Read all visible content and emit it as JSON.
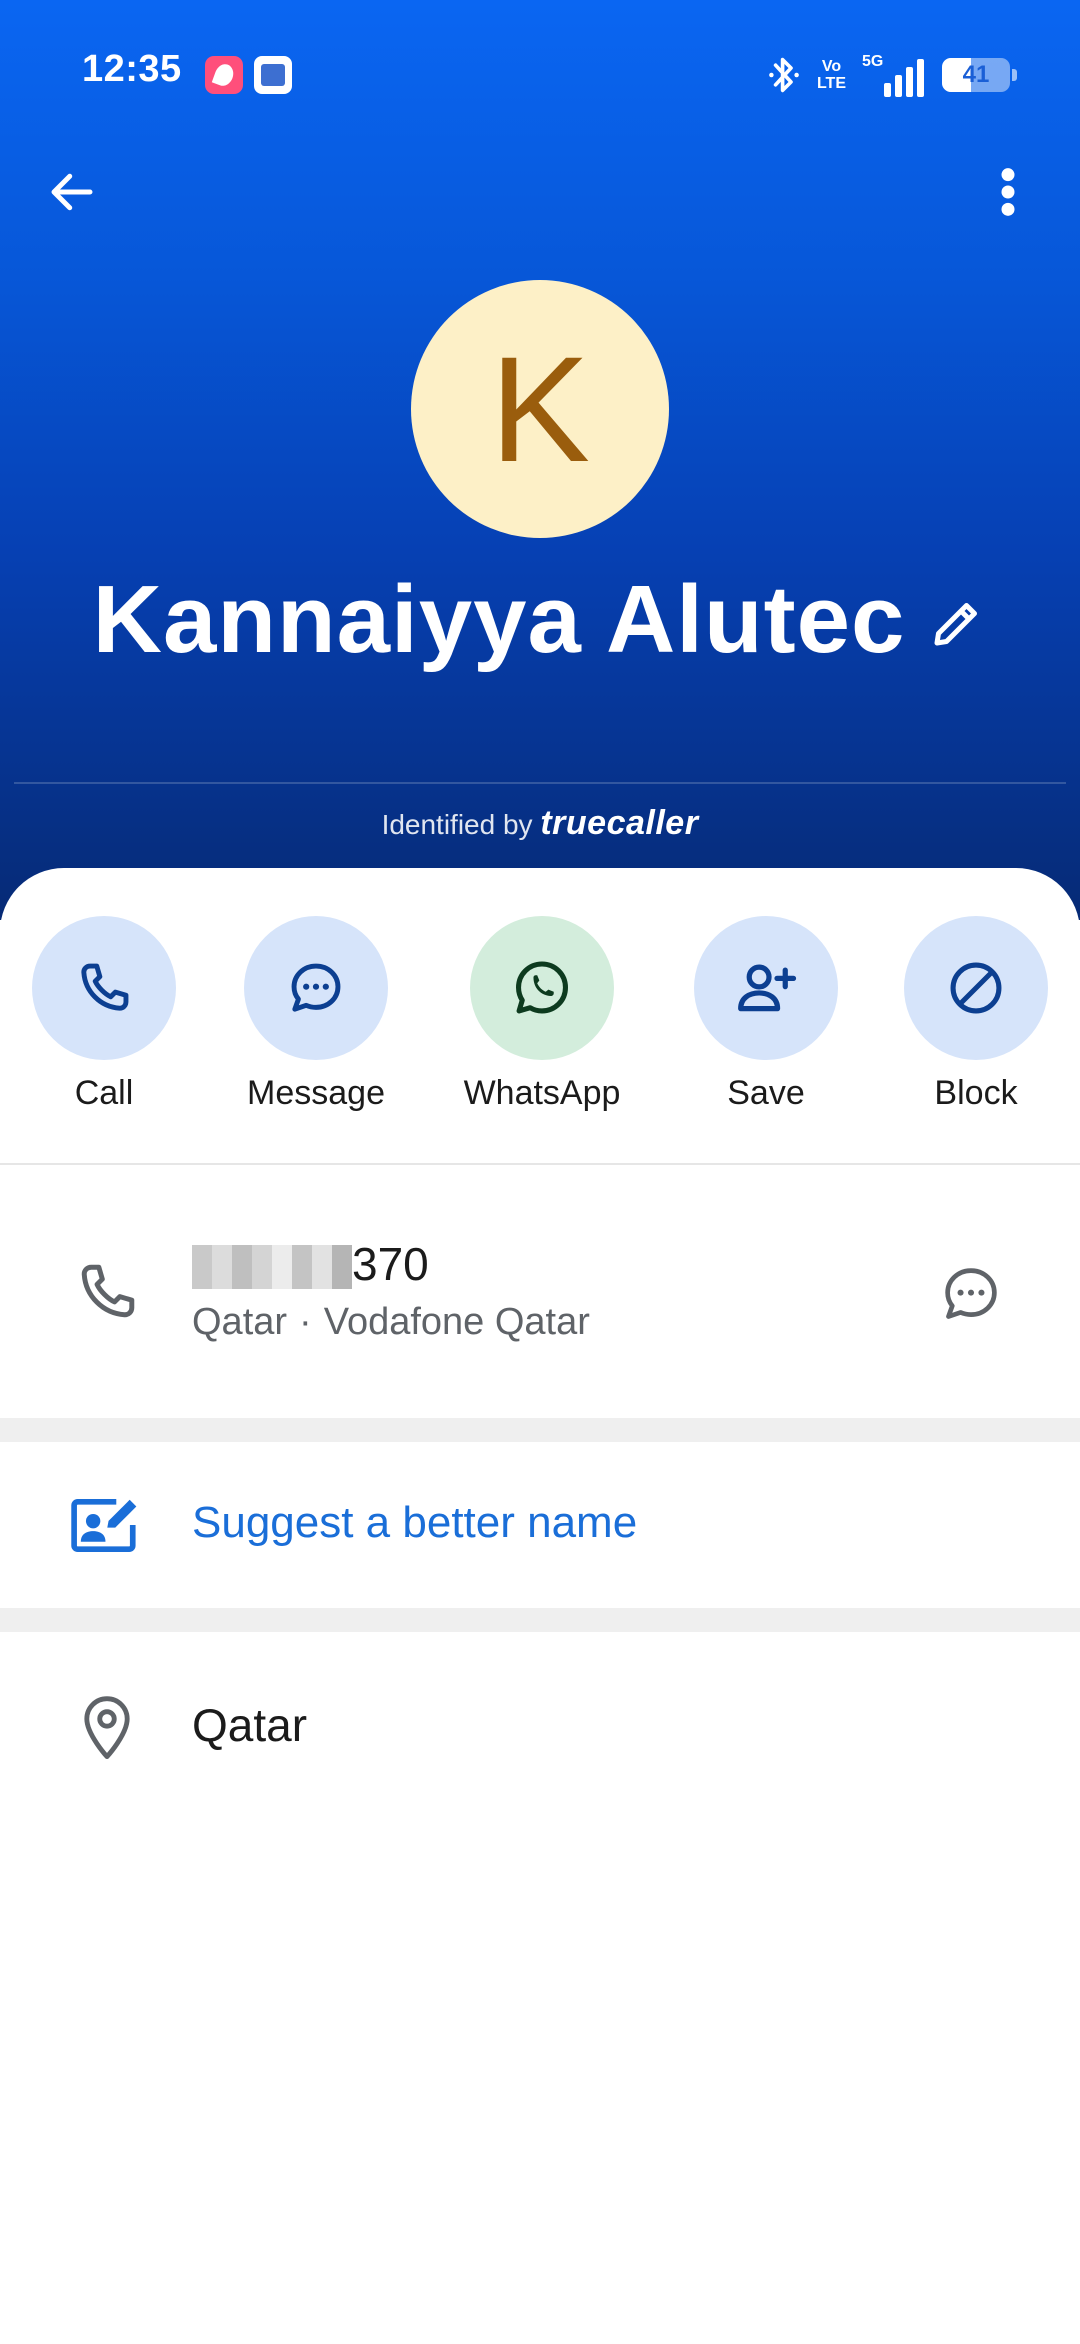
{
  "status_bar": {
    "time": "12:35",
    "volte_top": "Vo",
    "volte_bottom": "LTE",
    "network": "5G",
    "battery": "41"
  },
  "colors": {
    "header_top": "#0a66f2",
    "header_bottom": "#062a75",
    "avatar_bg": "#fdf0c7",
    "avatar_letter": "#9a5d0d",
    "action_bg": "#d6e4fa",
    "whatsapp_bg": "#d3eddc",
    "link": "#1a6ed8"
  },
  "contact": {
    "initial": "K",
    "name": "Kannaiyya Alutec",
    "identified_prefix": "Identified by",
    "identified_brand": "truecaller"
  },
  "actions": [
    {
      "label": "Call",
      "icon": "phone-icon"
    },
    {
      "label": "Message",
      "icon": "chat-bubble-icon"
    },
    {
      "label": "WhatsApp",
      "icon": "whatsapp-icon"
    },
    {
      "label": "Save",
      "icon": "add-person-icon"
    },
    {
      "label": "Block",
      "icon": "block-icon"
    }
  ],
  "phone": {
    "number_suffix": "370",
    "country": "Qatar",
    "separator": "·",
    "carrier": "Vodafone Qatar"
  },
  "suggest": {
    "label": "Suggest a better name"
  },
  "location": {
    "label": "Qatar"
  }
}
